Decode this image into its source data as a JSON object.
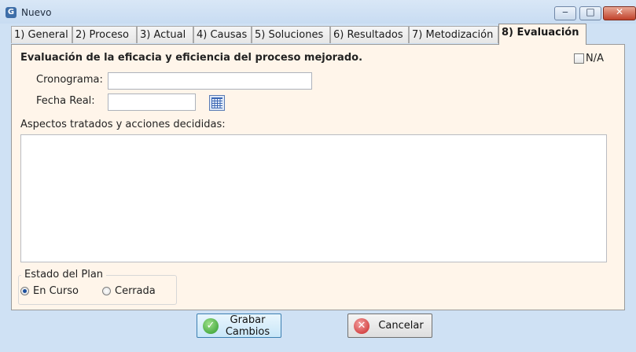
{
  "window": {
    "title": "Nuevo",
    "minimize_glyph": "‒",
    "maximize_glyph": "□",
    "close_glyph": "✕"
  },
  "tabs": [
    {
      "label": "1) General"
    },
    {
      "label": "2) Proceso"
    },
    {
      "label": "3) Actual"
    },
    {
      "label": "4) Causas"
    },
    {
      "label": "5) Soluciones"
    },
    {
      "label": "6) Resultados"
    },
    {
      "label": "7) Metodización"
    },
    {
      "label": "8) Evaluación",
      "active": true
    }
  ],
  "form": {
    "heading": "Evaluación de la eficacia y eficiencia del proceso mejorado.",
    "na_label": "N/A",
    "na_checked": false,
    "cronograma_label": "Cronograma:",
    "cronograma_value": "",
    "fecha_real_label": "Fecha Real:",
    "fecha_real_value": "",
    "aspectos_label": "Aspectos tratados y acciones decididas:",
    "aspectos_value": "",
    "estado": {
      "title": "Estado del Plan",
      "options": [
        "En Curso",
        "Cerrada"
      ],
      "selected": "En Curso"
    }
  },
  "buttons": {
    "save_line1": "Grabar",
    "save_line2": "Cambios",
    "cancel": "Cancelar"
  },
  "icons": {
    "app": "app-logo-icon",
    "calendar": "calendar-icon",
    "save": "checkmark-icon",
    "cancel": "x-circle-icon"
  },
  "colors": {
    "panel_bg": "#fff5ea",
    "window_bg": "#cfe1f4",
    "save_icon": "#2c9a2a",
    "cancel_icon": "#c92424"
  }
}
